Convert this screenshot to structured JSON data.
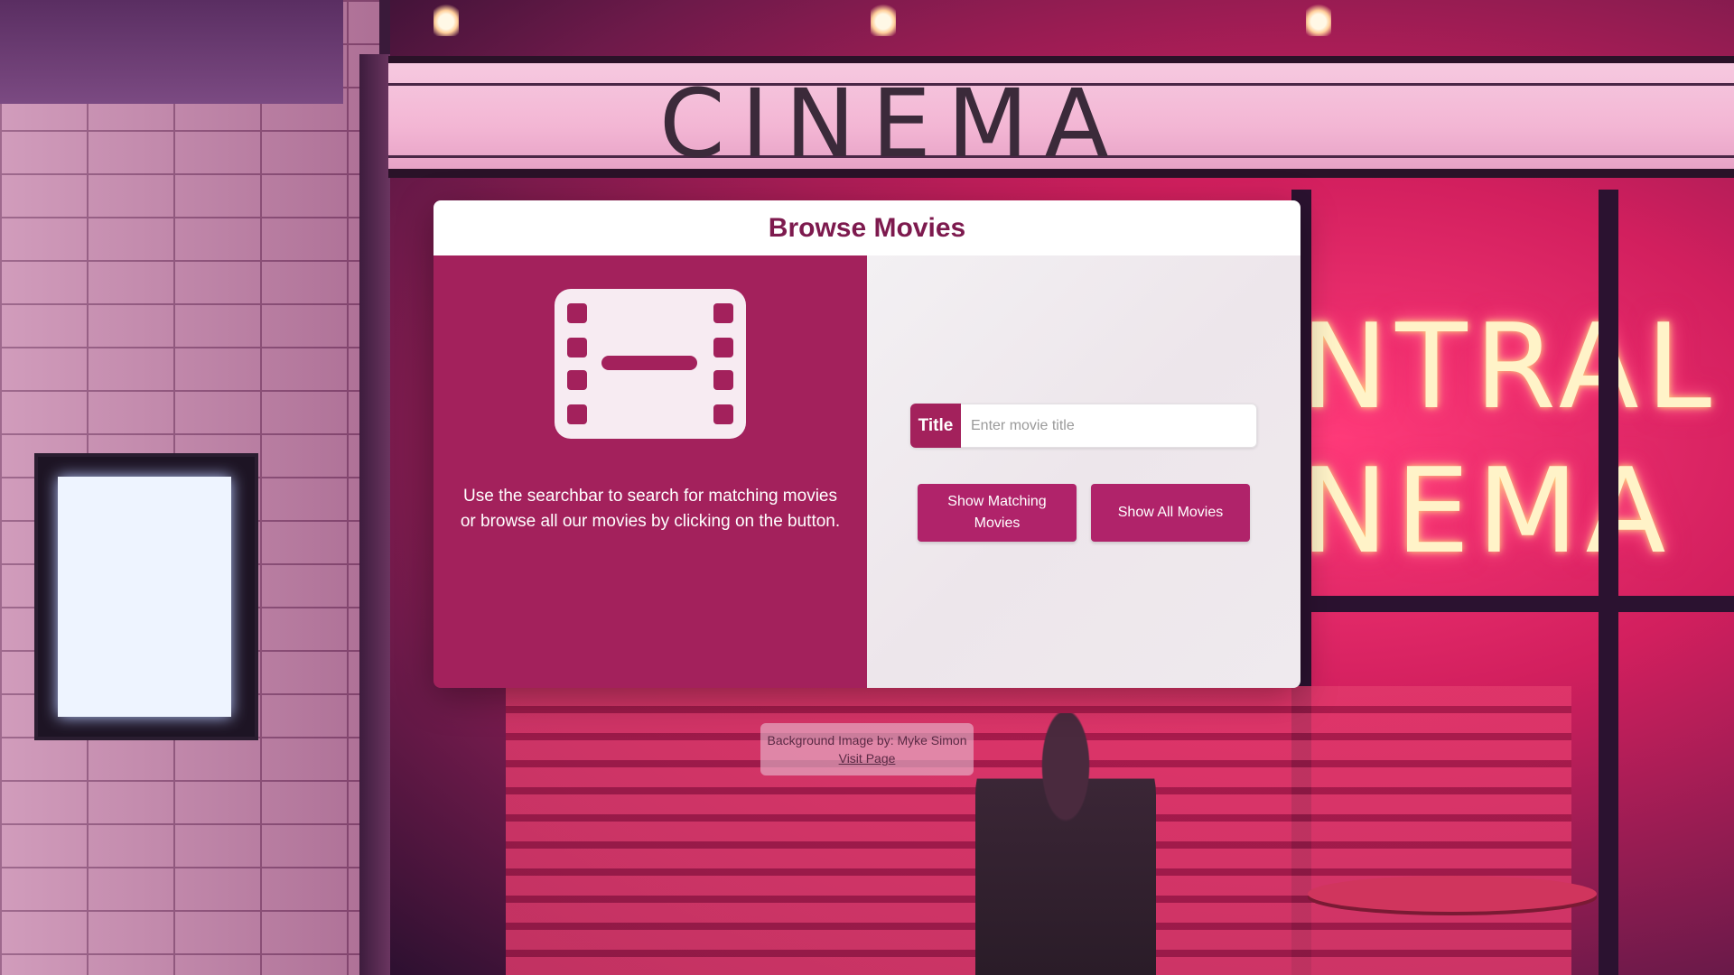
{
  "panel": {
    "title": "Browse Movies",
    "intro_text": "Use the searchbar to search for matching movies or browse all our movies by clicking on the button.",
    "icon": "film-icon"
  },
  "search": {
    "label": "Title",
    "placeholder": "Enter movie title",
    "value": ""
  },
  "buttons": {
    "show_matching": "Show Matching Movies",
    "show_all": "Show All Movies"
  },
  "credit": {
    "text": "Background Image by: Myke Simon",
    "link_label": "Visit Page"
  },
  "colors": {
    "accent": "#a3215c",
    "button": "#b0236a",
    "title": "#7d1a4e"
  }
}
